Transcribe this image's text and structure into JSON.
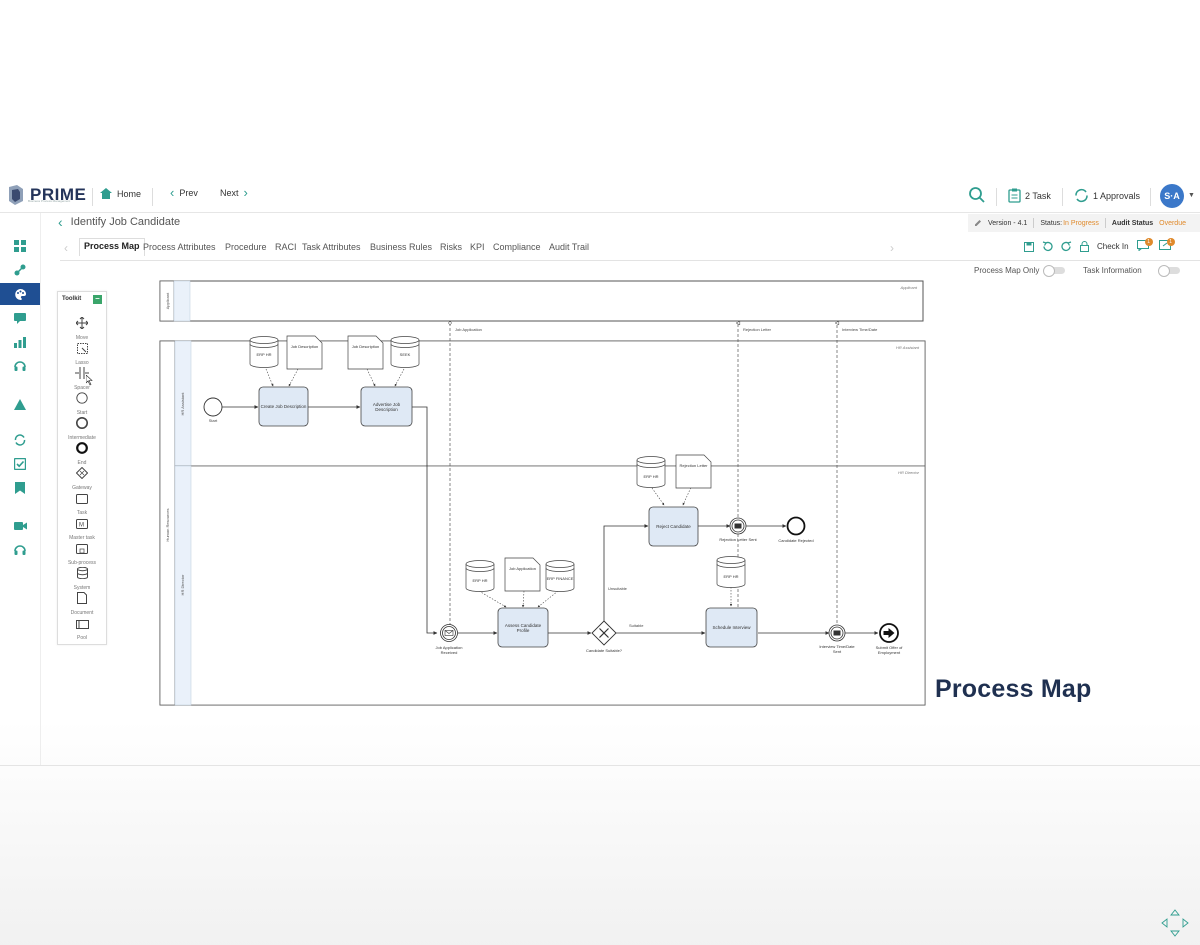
{
  "header": {
    "logo_text": "PRIME",
    "logo_sub": "Business Process Management",
    "home_label": "Home",
    "prev_label": "Prev",
    "next_label": "Next",
    "task_label": "2 Task",
    "approvals_label": "1 Approvals",
    "avatar_initials": "S·A"
  },
  "breadcrumb": {
    "title": "Identify Job Candidate"
  },
  "meta": {
    "version": "Version - 4.1",
    "status_label": "Status:",
    "status_value": "In Progress",
    "audit_label": "Audit Status",
    "audit_value": "Overdue"
  },
  "tabs": [
    {
      "label": "Process Map",
      "active": true
    },
    {
      "label": "Process Attributes"
    },
    {
      "label": "Procedure"
    },
    {
      "label": "RACI"
    },
    {
      "label": "Task Attributes"
    },
    {
      "label": "Business Rules"
    },
    {
      "label": "Risks"
    },
    {
      "label": "KPI"
    },
    {
      "label": "Compliance"
    },
    {
      "label": "Audit Trail"
    }
  ],
  "tools": {
    "check_in": "Check In",
    "badge1": "1",
    "badge2": "1"
  },
  "toggles": {
    "map_only": "Process Map Only",
    "task_info": "Task Information"
  },
  "toolkit": {
    "title": "Toolkit",
    "items": [
      "Move",
      "Lasso",
      "Spacer",
      "Start",
      "Intermediate",
      "End",
      "Gateway",
      "Task",
      "Master task",
      "Sub-process",
      "System",
      "Document",
      "Pool"
    ]
  },
  "diagram": {
    "pools": [
      {
        "name": "Applicant",
        "tag": "Applicant"
      },
      {
        "name": "Human Resources"
      }
    ],
    "lanes": [
      {
        "name": "HR Assistant",
        "tag": "HR Assistant"
      },
      {
        "name": "HR Director",
        "tag": "HR Director"
      }
    ],
    "message_labels": [
      "Job Application",
      "Rejection Letter",
      "Interview Time/Date"
    ],
    "events": [
      "Start",
      "Job Application Received",
      "Candidate Suitable?",
      "Rejection Letter Sent",
      "Candidate Rejected",
      "Interview Time/Date Sent",
      "Submit Offer of Employment"
    ],
    "tasks": [
      "Create Job Description",
      "Advertise Job Description",
      "Assess Candidate Profile",
      "Reject Candidate",
      "Schedule Interview"
    ],
    "systems": [
      "ERP HR",
      "SEEK",
      "ERP HR",
      "ERP FINANCE",
      "ERP HR",
      "ERP HR"
    ],
    "documents": [
      "Job Description",
      "Job Description",
      "Job Application",
      "Rejection Letter"
    ],
    "flow_labels": [
      "Unsuitable",
      "Suitable"
    ]
  },
  "caption": "Process Map",
  "colors": {
    "accent": "#2f9d8f",
    "active_nav": "#1f4f93",
    "task_fill": "#dfe9f5",
    "warn": "#e08a2c"
  }
}
